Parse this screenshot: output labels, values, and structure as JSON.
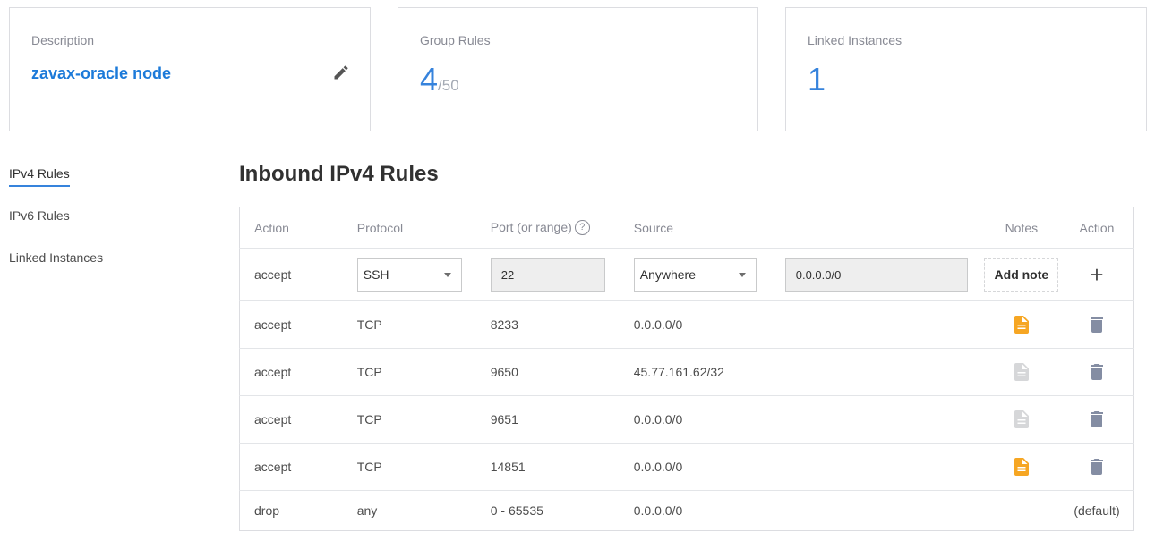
{
  "cards": {
    "description": {
      "label": "Description",
      "value": "zavax-oracle node"
    },
    "group_rules": {
      "label": "Group Rules",
      "count": "4",
      "max": "/50"
    },
    "linked_instances": {
      "label": "Linked Instances",
      "count": "1"
    }
  },
  "side_nav": {
    "items": [
      {
        "label": "IPv4 Rules"
      },
      {
        "label": "IPv6 Rules"
      },
      {
        "label": "Linked Instances"
      }
    ]
  },
  "section_title": "Inbound IPv4 Rules",
  "table": {
    "headers": {
      "action": "Action",
      "protocol": "Protocol",
      "port": "Port (or range)",
      "help": "?",
      "source": "Source",
      "notes": "Notes",
      "action2": "Action"
    },
    "edit_row": {
      "action": "accept",
      "protocol": "SSH",
      "port": "22",
      "source_select": "Anywhere",
      "source_value": "0.0.0.0/0",
      "add_note": "Add note",
      "add": "+"
    },
    "rows": [
      {
        "action": "accept",
        "protocol": "TCP",
        "port": "8233",
        "source": "0.0.0.0/0"
      },
      {
        "action": "accept",
        "protocol": "TCP",
        "port": "9650",
        "source": "45.77.161.62/32"
      },
      {
        "action": "accept",
        "protocol": "TCP",
        "port": "9651",
        "source": "0.0.0.0/0"
      },
      {
        "action": "accept",
        "protocol": "TCP",
        "port": "14851",
        "source": "0.0.0.0/0"
      }
    ],
    "default_row": {
      "action": "drop",
      "protocol": "any",
      "port": "0 - 65535",
      "source": "0.0.0.0/0",
      "note": "(default)"
    }
  },
  "colors": {
    "accent": "#3683dc",
    "note_active": "#f6a623",
    "note_inactive": "#d6d7d9",
    "trash": "#848da3"
  },
  "icons": {
    "edit": "pencil-icon",
    "note": "note-icon",
    "trash": "trash-icon",
    "help": "help-icon"
  }
}
